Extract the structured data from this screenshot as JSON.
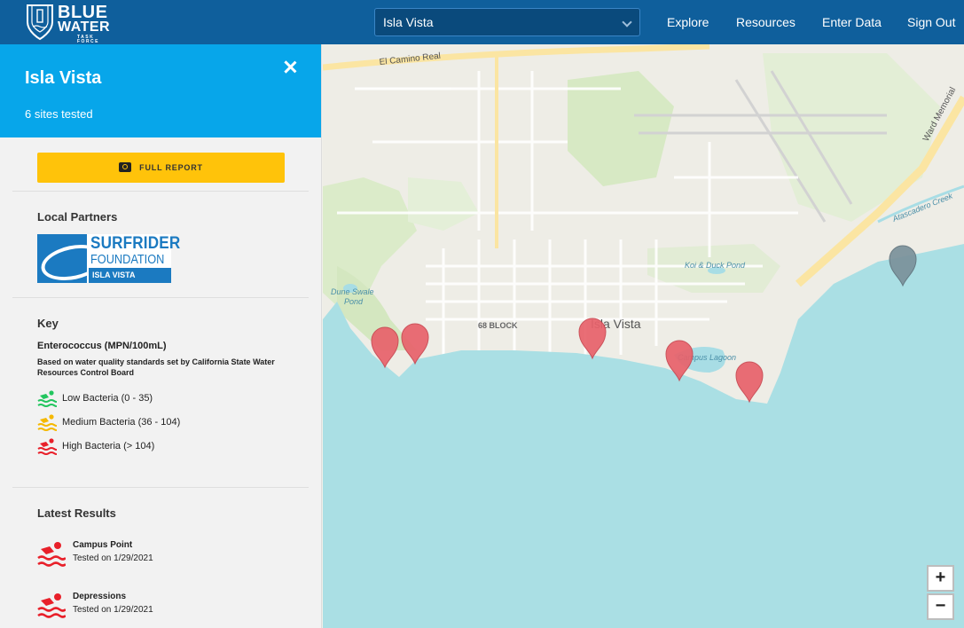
{
  "header": {
    "logo_line1": "BLUE",
    "logo_line2": "WATER",
    "logo_line3": "TASK FORCE",
    "location_selected": "Isla Vista",
    "nav": [
      "Explore",
      "Resources",
      "Enter Data",
      "Sign Out"
    ]
  },
  "sidebar": {
    "title": "Isla Vista",
    "subtitle": "6 sites tested",
    "full_report_label": "FULL REPORT",
    "partners_title": "Local Partners",
    "partner_logo": {
      "line1": "SURFRIDER",
      "line2": "FOUNDATION",
      "line3": "ISLA VISTA"
    },
    "key_title": "Key",
    "key_measure": "Enterococcus (MPN/100mL)",
    "key_note": "Based on water quality standards set by California State Water Resources Control Board",
    "key_items": [
      {
        "label": "Low Bacteria (0 - 35)",
        "color": "#22c55e"
      },
      {
        "label": "Medium Bacteria (36 - 104)",
        "color": "#f5b800"
      },
      {
        "label": "High Bacteria (> 104)",
        "color": "#e8202a"
      }
    ],
    "latest_title": "Latest Results",
    "results": [
      {
        "name": "Campus Point",
        "date": "Tested on 1/29/2021"
      },
      {
        "name": "Depressions",
        "date": "Tested on 1/29/2021"
      }
    ]
  },
  "map": {
    "labels": {
      "el_camino": "El Camino Real",
      "ward_memorial": "Ward Memorial",
      "atascadero": "Atascadero Creek",
      "kol_duck": "Koi & Duck Pond",
      "dune_swale_1": "Dune Swale",
      "dune_swale_2": "Pond",
      "block68": "68 BLOCK",
      "isla_vista": "Isla Vista",
      "campus_lagoon": "Campus Lagoon"
    },
    "marker_colors": {
      "high": "#e8626b",
      "inactive": "#7b919b"
    },
    "zoom_in": "+",
    "zoom_out": "−"
  }
}
